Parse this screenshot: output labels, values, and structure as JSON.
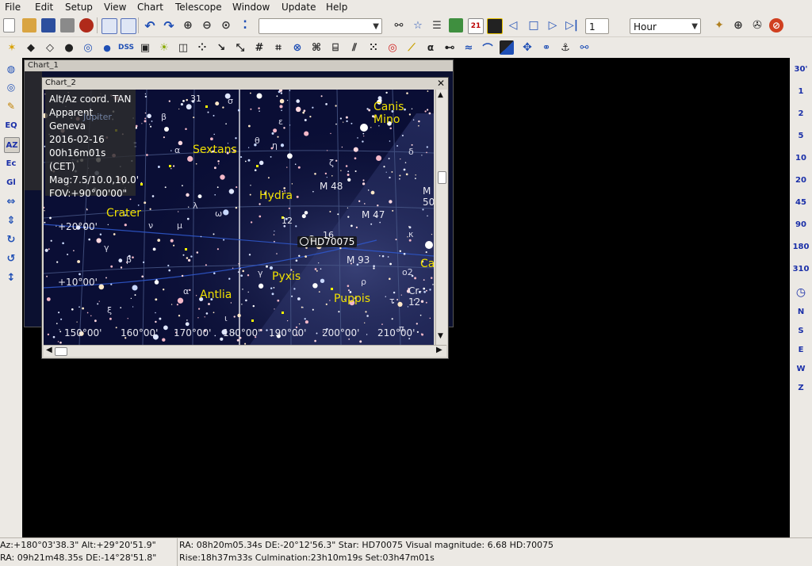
{
  "menubar": {
    "items": [
      "File",
      "Edit",
      "Setup",
      "View",
      "Chart",
      "Telescope",
      "Window",
      "Update",
      "Help"
    ]
  },
  "toolbar": {
    "object_search_value": "",
    "step_value": "1",
    "time_unit": "Hour",
    "dss_label": "DSS",
    "eq_label": "EQ",
    "az_label": "AZ",
    "ec_label": "Ec",
    "gl_label": "Gl",
    "alpha_label": "α"
  },
  "fov_buttons": [
    "30'",
    "1",
    "2",
    "5",
    "10",
    "20",
    "45",
    "90",
    "180",
    "310"
  ],
  "direction_buttons": [
    "N",
    "S",
    "E",
    "W",
    "Z"
  ],
  "chart1": {
    "title": "Chart_1"
  },
  "chart2": {
    "title": "Chart_2",
    "info": [
      "Alt/Az coord. TAN",
      "Apparent",
      "Geneva",
      "2016-02-16",
      "00h16m01s (CET)",
      "Mag:7.5/10.0,10.0'",
      "FOV:+90°00'00\""
    ],
    "constellations": [
      "Canis Mino",
      "Sextans",
      "Hydra",
      "Crater",
      "Antlia",
      "Pyxis",
      "Puppis",
      "Ca"
    ],
    "objects": [
      "M 48",
      "M 47",
      "M 93",
      "M 50",
      "Cr-12",
      "HD70075",
      "12",
      "16",
      "31",
      "Jupiter"
    ],
    "alt_labels": [
      "+20°00'",
      "+10°00'"
    ],
    "az_labels": [
      "150°00'",
      "160°00'",
      "170°00'",
      "180°00'",
      "190°00'",
      "200°00'",
      "210°00'"
    ],
    "greek": [
      "β",
      "σ",
      "α",
      "λ",
      "ν",
      "μ",
      "ω",
      "θ",
      "η",
      "ε",
      "ζ",
      "γ",
      "δ",
      "ξ",
      "ι",
      "π",
      "α",
      "β",
      "γ",
      "τ",
      "ρ",
      "ο2",
      "κ"
    ]
  },
  "status": {
    "altaz": "Az:+180°03'38.3\" Alt:+29°20'51.9\"",
    "radec": "RA: 09h21m48.35s DE:-14°28'51.8\"",
    "object_line1": "RA: 08h20m05.34s DE:-20°12'56.3\"  Star: HD70075  Visual magnitude:  6.68  HD:70075",
    "object_line2": "Rise:18h37m33s  Culmination:23h10m19s  Set:03h47m01s"
  }
}
